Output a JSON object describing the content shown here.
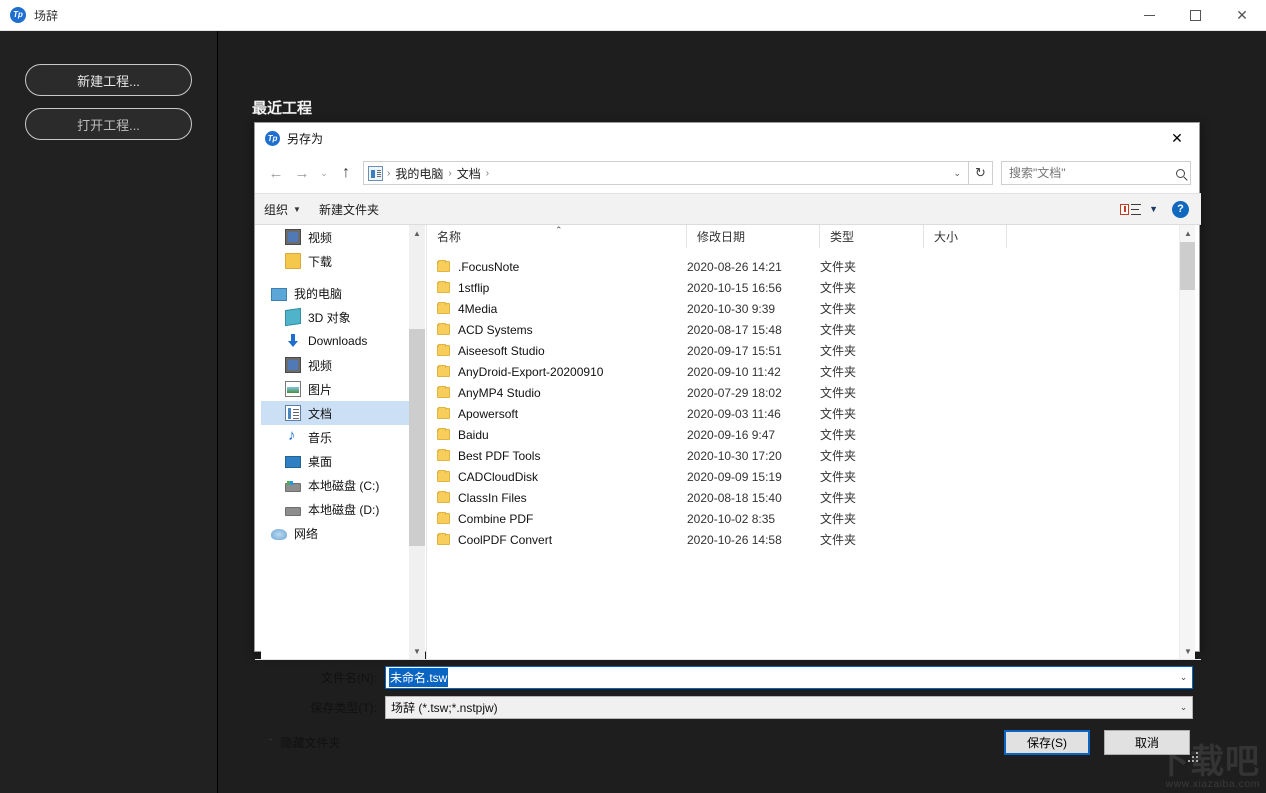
{
  "app": {
    "title": "场辞",
    "icon": "Tp",
    "window_controls": {
      "minimize": "—",
      "maximize": "□",
      "close": "✕"
    },
    "sidebar": {
      "new_project": "新建工程...",
      "open_project": "打开工程..."
    },
    "recent_title": "最近工程"
  },
  "watermark": {
    "logo": "下载吧",
    "url": "www.xiazaiba.com"
  },
  "dialog": {
    "title": "另存为",
    "icon": "Tp",
    "close": "✕",
    "nav": {
      "back": "←",
      "forward": "→",
      "history": "⌄",
      "up": "↑",
      "refresh": "↻",
      "breadcrumb": [
        "我的电脑",
        "文档"
      ],
      "breadcrumb_sep": "›",
      "breadcrumb_caret": "⌄"
    },
    "search": {
      "placeholder": "搜索\"文档\"",
      "value": ""
    },
    "commandbar": {
      "organize": "组织",
      "organize_caret": "▼",
      "new_folder": "新建文件夹",
      "view_caret": "▼",
      "help": "?"
    },
    "nav_pane": [
      {
        "label": "视频",
        "icon": "video-icon",
        "indent": true,
        "selected": false
      },
      {
        "label": "下载",
        "icon": "folder-icon",
        "indent": true,
        "selected": false
      },
      {
        "label": "我的电脑",
        "icon": "computer-icon",
        "indent": false,
        "selected": false
      },
      {
        "label": "3D 对象",
        "icon": "3d-object-icon",
        "indent": true,
        "selected": false
      },
      {
        "label": "Downloads",
        "icon": "download-icon",
        "indent": true,
        "selected": false
      },
      {
        "label": "视频",
        "icon": "video-icon",
        "indent": true,
        "selected": false
      },
      {
        "label": "图片",
        "icon": "pictures-icon",
        "indent": true,
        "selected": false
      },
      {
        "label": "文档",
        "icon": "documents-icon",
        "indent": true,
        "selected": true
      },
      {
        "label": "音乐",
        "icon": "music-icon",
        "indent": true,
        "selected": false
      },
      {
        "label": "桌面",
        "icon": "desktop-icon",
        "indent": true,
        "selected": false
      },
      {
        "label": "本地磁盘 (C:)",
        "icon": "system-drive-icon",
        "indent": true,
        "selected": false
      },
      {
        "label": "本地磁盘 (D:)",
        "icon": "drive-icon",
        "indent": true,
        "selected": false
      },
      {
        "label": "网络",
        "icon": "network-icon",
        "indent": false,
        "selected": false
      }
    ],
    "columns": [
      "名称",
      "修改日期",
      "类型",
      "大小"
    ],
    "sort_indicator": "⌃",
    "files": [
      {
        "name": ".FocusNote",
        "date": "2020-08-26 14:21",
        "type": "文件夹",
        "size": ""
      },
      {
        "name": "1stflip",
        "date": "2020-10-15 16:56",
        "type": "文件夹",
        "size": ""
      },
      {
        "name": "4Media",
        "date": "2020-10-30 9:39",
        "type": "文件夹",
        "size": ""
      },
      {
        "name": "ACD Systems",
        "date": "2020-08-17 15:48",
        "type": "文件夹",
        "size": ""
      },
      {
        "name": "Aiseesoft Studio",
        "date": "2020-09-17 15:51",
        "type": "文件夹",
        "size": ""
      },
      {
        "name": "AnyDroid-Export-20200910",
        "date": "2020-09-10 11:42",
        "type": "文件夹",
        "size": ""
      },
      {
        "name": "AnyMP4 Studio",
        "date": "2020-07-29 18:02",
        "type": "文件夹",
        "size": ""
      },
      {
        "name": "Apowersoft",
        "date": "2020-09-03 11:46",
        "type": "文件夹",
        "size": ""
      },
      {
        "name": "Baidu",
        "date": "2020-09-16 9:47",
        "type": "文件夹",
        "size": ""
      },
      {
        "name": "Best PDF Tools",
        "date": "2020-10-30 17:20",
        "type": "文件夹",
        "size": ""
      },
      {
        "name": "CADCloudDisk",
        "date": "2020-09-09 15:19",
        "type": "文件夹",
        "size": ""
      },
      {
        "name": "ClassIn Files",
        "date": "2020-08-18 15:40",
        "type": "文件夹",
        "size": ""
      },
      {
        "name": "Combine PDF",
        "date": "2020-10-02 8:35",
        "type": "文件夹",
        "size": ""
      },
      {
        "name": "CoolPDF Convert",
        "date": "2020-10-26 14:58",
        "type": "文件夹",
        "size": ""
      }
    ],
    "form": {
      "filename_label": "文件名(N):",
      "filename_value": "未命名.tsw",
      "filetype_label": "保存类型(T):",
      "filetype_value": "场辞 (*.tsw;*.nstpjw)",
      "combo_caret": "⌄"
    },
    "footer": {
      "hide_folders": "隐藏文件夹",
      "hide_folders_caret": "⌃",
      "save": "保存(S)",
      "cancel": "取消"
    }
  }
}
